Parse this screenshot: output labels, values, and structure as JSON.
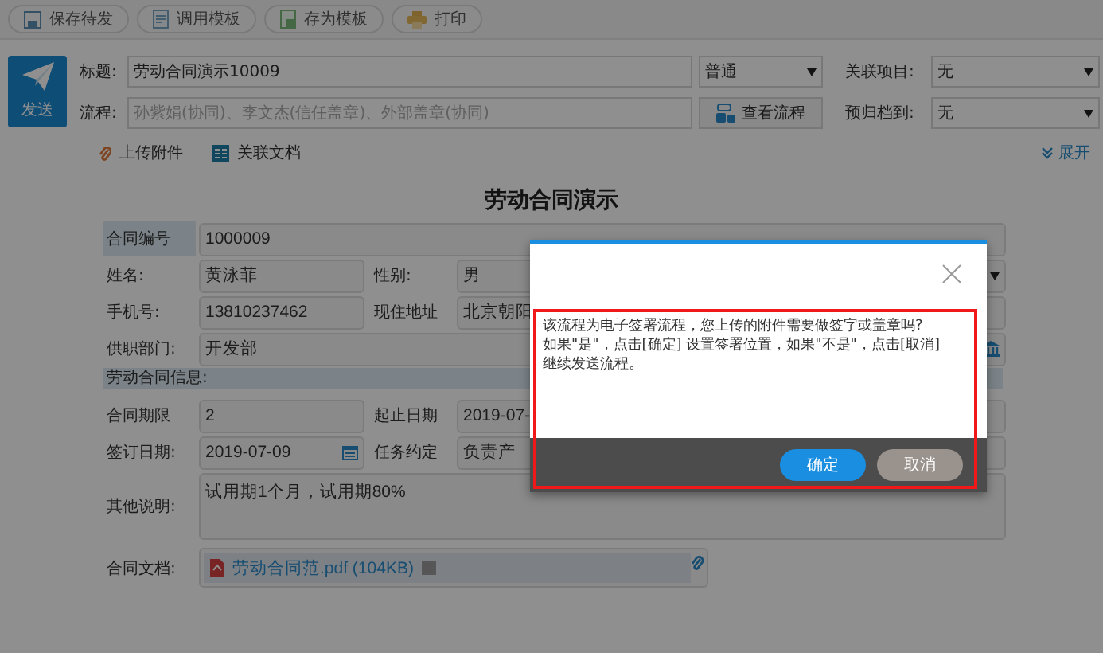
{
  "toolbar": [
    {
      "label": "保存待发"
    },
    {
      "label": "调用模板"
    },
    {
      "label": "存为模板"
    },
    {
      "label": "打印"
    }
  ],
  "send_button": {
    "label": "发送"
  },
  "header": {
    "title_field": {
      "label": "标题:",
      "value": "劳动合同演示10009"
    },
    "priority_select": {
      "value": "普通"
    },
    "related_project": {
      "label": "关联项目:",
      "value": "无"
    },
    "process_field": {
      "label": "流程:",
      "placeholder": "孙紫娟(协同)、李文杰(信任盖章)、外部盖章(协同)"
    },
    "view_process_button": {
      "label": "查看流程"
    },
    "archive_select": {
      "label": "预归档到:",
      "value": "无"
    }
  },
  "links": {
    "upload": "上传附件",
    "related_docs": "关联文档",
    "expand": "展开"
  },
  "form": {
    "title": "劳动合同演示",
    "rows": [
      {
        "kind": "header",
        "cells": [
          {
            "label": "合同编号",
            "value": "1000009",
            "kind": "text"
          }
        ]
      },
      {
        "kind": "field",
        "cells": [
          {
            "label": "姓名:",
            "value": "黄泳菲",
            "kind": "text"
          },
          {
            "label": "性别:",
            "value": "男",
            "kind": "select"
          }
        ]
      },
      {
        "kind": "field",
        "cells": [
          {
            "label": "手机号:",
            "value": "13810237462",
            "kind": "text"
          },
          {
            "label": "现住地址",
            "value": "北京朝阳",
            "kind": "text"
          }
        ]
      },
      {
        "kind": "field",
        "cells": [
          {
            "label": "供职部门:",
            "value": "开发部",
            "kind": "lookup"
          }
        ]
      },
      {
        "kind": "section",
        "cells": [
          {
            "label": "劳动合同信息:"
          }
        ]
      },
      {
        "kind": "field",
        "cells": [
          {
            "label": "合同期限",
            "value": "2",
            "kind": "text"
          },
          {
            "label": "起止日期",
            "value": "2019-07-",
            "kind": "text"
          }
        ]
      },
      {
        "kind": "field",
        "cells": [
          {
            "label": "签订日期:",
            "value": "2019-07-09",
            "kind": "date"
          },
          {
            "label": "任务约定",
            "value": "负责产",
            "kind": "text"
          }
        ]
      },
      {
        "kind": "note",
        "cells": [
          {
            "label": "其他说明:",
            "value": "试用期1个月，试用期80%",
            "kind": "text"
          }
        ]
      },
      {
        "kind": "file",
        "cells": [
          {
            "label": "合同文档:",
            "value": "劳动合同范.pdf (104KB)",
            "kind": "file"
          }
        ]
      }
    ]
  },
  "modal": {
    "message": "该流程为电子签署流程，您上传的附件需要做签字或盖章吗?\n如果\"是\"，点击[确定] 设置签署位置，如果\"不是\"，点击[取消]\n继续发送流程。",
    "highlighted": true,
    "buttons": [
      {
        "label": "确定",
        "kind": "primary"
      },
      {
        "label": "取消",
        "kind": "secondary"
      }
    ]
  }
}
